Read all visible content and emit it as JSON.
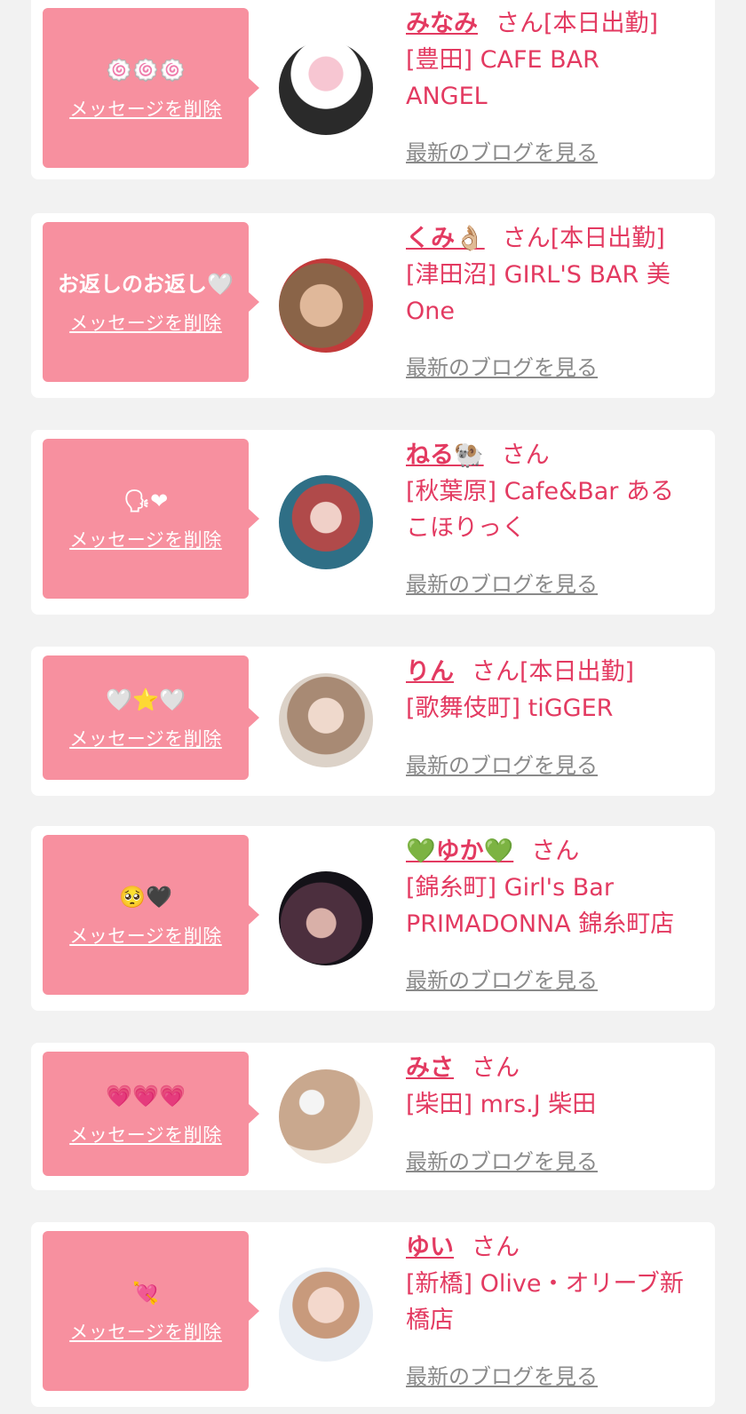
{
  "messages": [
    {
      "reply": "🍥🍥🍥",
      "name": "みなみ",
      "suffix": "さん[本日出勤]",
      "shop_lines": [
        "[豊田] CAFE BAR",
        "ANGEL"
      ],
      "delete_label": "メッセージを削除",
      "blog_label": "最新のブログを見る",
      "avatar_colors": [
        "#f7d7e0",
        "#2a2a2a"
      ]
    },
    {
      "reply": "お返しのお返し🤍",
      "name": "くみ👌🏼",
      "suffix": "さん[本日出勤]",
      "shop_lines": [
        "[津田沼] GIRL'S BAR 美",
        "One"
      ],
      "delete_label": "メッセージを削除",
      "blog_label": "最新のブログを見る",
      "avatar_colors": [
        "#c9a27a",
        "#5a3a2e"
      ]
    },
    {
      "reply": "🗣❤",
      "name": "ねる🐏",
      "suffix": "さん",
      "shop_lines": [
        "[秋葉原] Cafe&Bar ある",
        "こほりっく"
      ],
      "delete_label": "メッセージを削除",
      "blog_label": "最新のブログを見る",
      "avatar_colors": [
        "#3c6f7f",
        "#b04a4a"
      ]
    },
    {
      "reply": "🤍⭐️🤍",
      "name": "りん",
      "suffix": "さん[本日出勤]",
      "shop_lines": [
        "[歌舞伎町] tiGGER"
      ],
      "delete_label": "メッセージを削除",
      "blog_label": "最新のブログを見る",
      "avatar_colors": [
        "#b9a89a",
        "#6c5a4e"
      ]
    },
    {
      "reply": "🥺🖤",
      "name": "💚ゆか💚",
      "suffix": "さん",
      "shop_lines": [
        "[錦糸町] Girl's Bar",
        "PRIMADONNA 錦糸町店"
      ],
      "delete_label": "メッセージを削除",
      "blog_label": "最新のブログを見る",
      "avatar_colors": [
        "#6b4a5a",
        "#1e1a22"
      ]
    },
    {
      "reply": "💗💗💗",
      "name": "みさ",
      "suffix": "さん",
      "shop_lines": [
        "[柴田] mrs.J 柴田"
      ],
      "delete_label": "メッセージを削除",
      "blog_label": "最新のブログを見る",
      "avatar_colors": [
        "#d8c3b0",
        "#8c6e56"
      ]
    },
    {
      "reply": "💘",
      "name": "ゆい",
      "suffix": "さん",
      "shop_lines": [
        "[新橋] Olive・オリーブ新",
        "橋店"
      ],
      "delete_label": "メッセージを削除",
      "blog_label": "最新のブログを見る",
      "avatar_colors": [
        "#e8ddd8",
        "#a88c84"
      ]
    }
  ],
  "colors": {
    "bubble": "#f7909f",
    "name": "#e33a61",
    "link_gray": "#8a8a8a",
    "background": "#f2f2f2"
  }
}
